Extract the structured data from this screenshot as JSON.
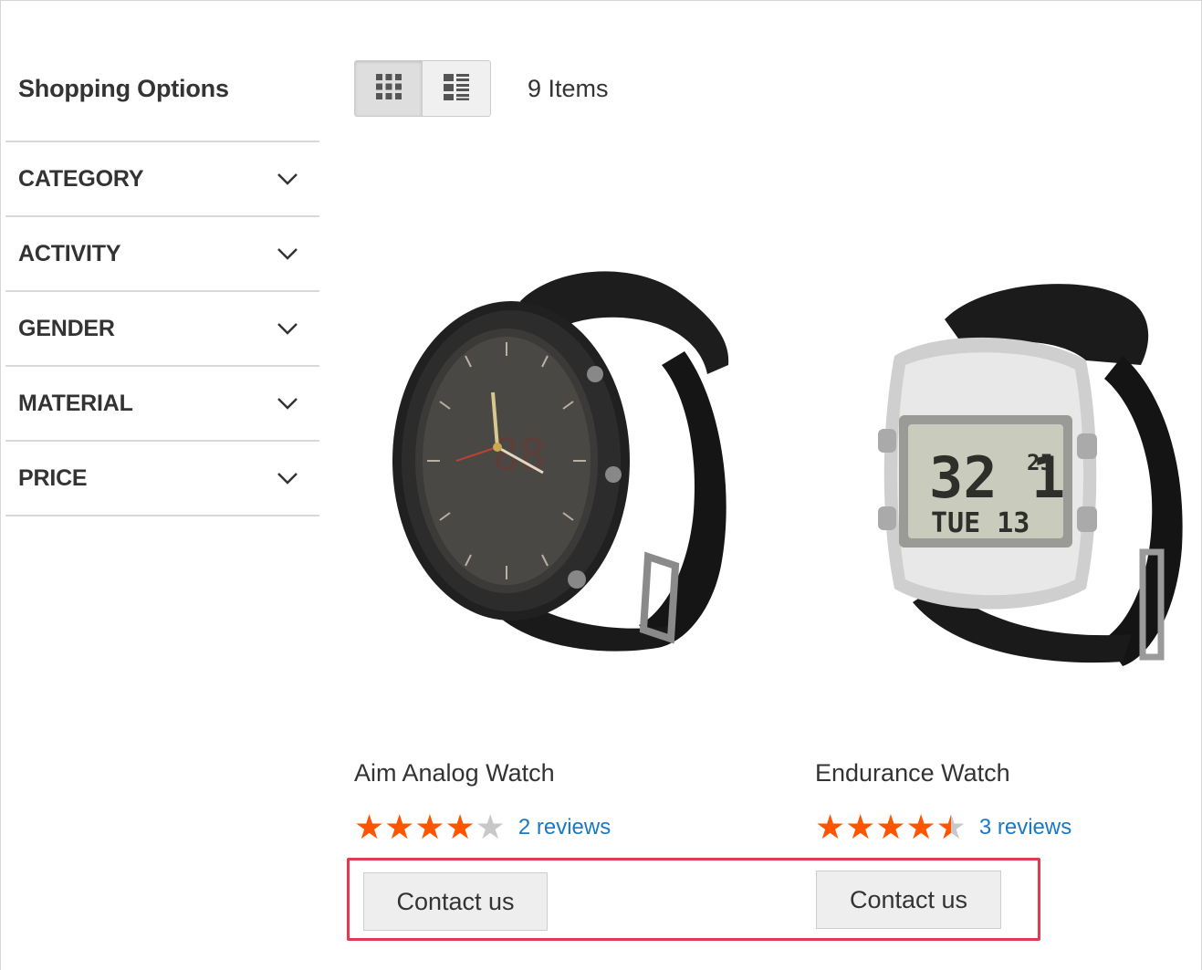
{
  "sidebar": {
    "title": "Shopping Options",
    "filters": [
      {
        "label": "CATEGORY",
        "icon": "chevron-down-icon"
      },
      {
        "label": "ACTIVITY",
        "icon": "chevron-down-icon"
      },
      {
        "label": "GENDER",
        "icon": "chevron-down-icon"
      },
      {
        "label": "MATERIAL",
        "icon": "chevron-down-icon"
      },
      {
        "label": "PRICE",
        "icon": "chevron-down-icon"
      }
    ]
  },
  "toolbar": {
    "view_modes": [
      {
        "name": "grid",
        "icon": "grid-view-icon",
        "active": true
      },
      {
        "name": "list",
        "icon": "list-view-icon",
        "active": false
      }
    ],
    "items_count": "9 Items"
  },
  "products": [
    {
      "name": "Aim Analog Watch",
      "rating": 4,
      "rating_max": 5,
      "reviews": "2 reviews",
      "button": "Contact us",
      "image": "black-analog-watch-image"
    },
    {
      "name": "Endurance Watch",
      "rating": 4.5,
      "rating_max": 5,
      "reviews": "3 reviews",
      "button": "Contact us",
      "image": "silver-digital-watch-image"
    }
  ],
  "digital_watch_display": {
    "time": "32 1",
    "seconds": "25",
    "day": "TUE 13"
  },
  "colors": {
    "star_filled": "#ff5501",
    "star_empty": "#c8c8c8",
    "link": "#1979c3",
    "highlight": "#e23b4e"
  }
}
